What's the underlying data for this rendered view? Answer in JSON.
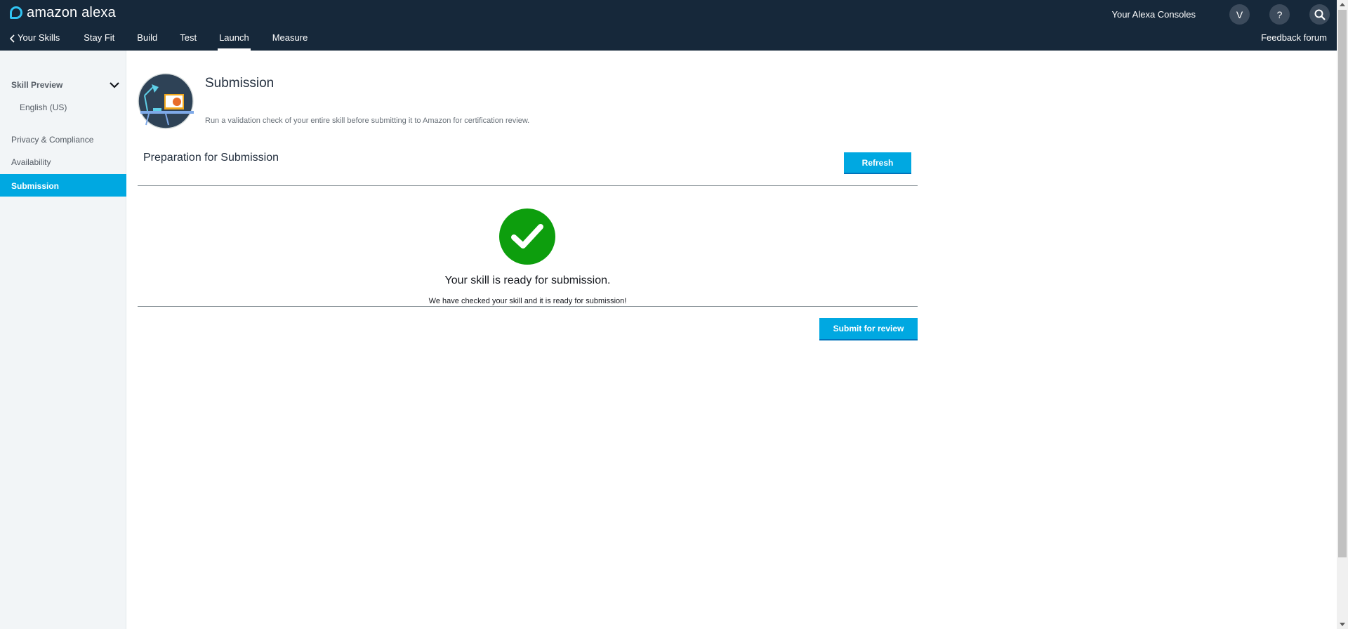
{
  "header": {
    "brand": "amazon alexa",
    "consoles": "Your Alexa Consoles",
    "avatar_initial": "V",
    "help_label": "?",
    "feedback": "Feedback forum",
    "nav": [
      {
        "label": "Your Skills"
      },
      {
        "label": "Stay Fit"
      },
      {
        "label": "Build"
      },
      {
        "label": "Test"
      },
      {
        "label": "Launch",
        "active": true
      },
      {
        "label": "Measure"
      }
    ]
  },
  "sidebar": {
    "skill_preview": "Skill Preview",
    "english": "English (US)",
    "privacy": "Privacy & Compliance",
    "availability": "Availability",
    "submission": "Submission"
  },
  "main": {
    "title": "Submission",
    "description": "Run a validation check of your entire skill before submitting it to Amazon for certification review.",
    "prep_title": "Preparation for Submission",
    "refresh_label": "Refresh",
    "ready_title": "Your skill is ready for submission.",
    "ready_desc": "We have checked your skill and it is ready for submission!",
    "submit_label": "Submit for review"
  },
  "colors": {
    "header_bg": "#16283a",
    "accent": "#00a8e1",
    "success": "#0d9e0d",
    "sidebar_bg": "#f2f5f7"
  },
  "icons": [
    "alexa-ring-icon",
    "chevron-left-icon",
    "help-icon",
    "search-icon",
    "chevron-down-icon",
    "desk-lamp-illustration",
    "checkmark-icon"
  ]
}
